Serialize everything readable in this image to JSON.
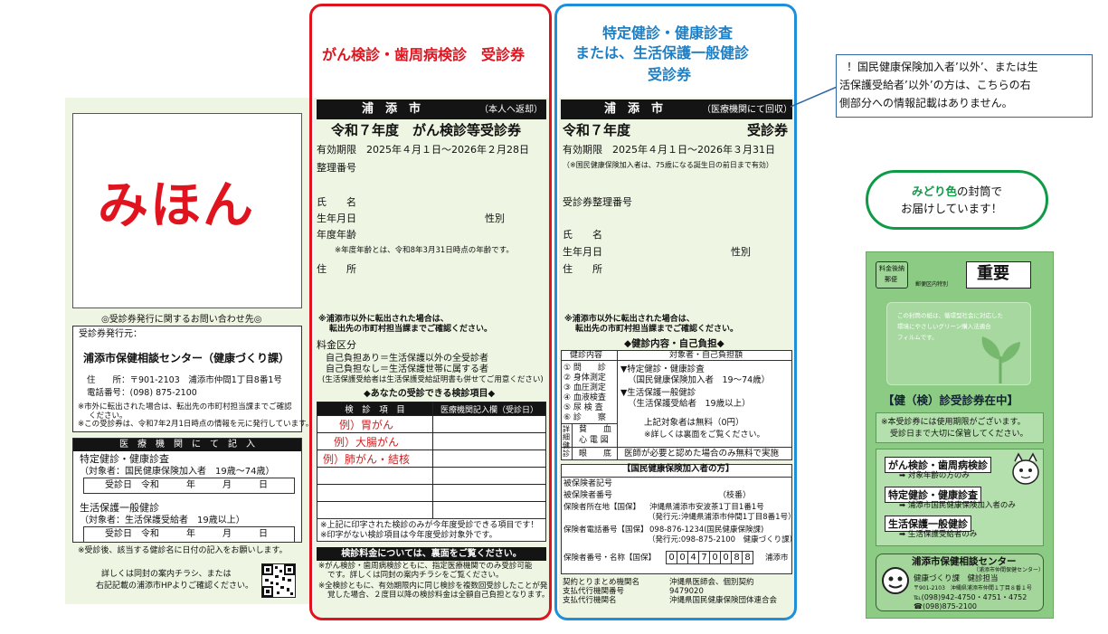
{
  "left": {
    "sample_stamp": "みほん",
    "inquiry_title": "◎受診券発行に関するお問い合わせ先◎",
    "issuer_label": "受診券発行元：",
    "center_name": "浦添市保健相談センター（健康づくり課）",
    "address": "住　　所：〒901-2103　浦添市仲間1丁目8番1号",
    "phone": "電話番号：(098) 875-2100",
    "note1": "※市外に転出された場合は、転出先の市町村担当課までご確認",
    "note1b": "ください。",
    "note2": "※この受診券は、令和7年2月1日時点の情報を元に発行しています。",
    "medical_header": "医　療　機　関　に　て　記　入",
    "tokutei_title": "特定健診・健康診査",
    "tokutei_target": "（対象者：国民健康保険加入者　19歳〜74歳）",
    "date_row": "受診日　令和　　　年　　　月　　　日",
    "seikatsu_title": "生活保護一般健診",
    "seikatsu_target": "（対象者：生活保護受給者　19歳以上）",
    "after_note": "※受診後、該当する健診名に日付の記入をお願いします。",
    "footer1": "詳しくは同封の案内チラシ、または",
    "footer2": "右記記載の浦添市HPよりご確認ください。"
  },
  "middle": {
    "heading": "がん検診・歯周病検診　受診券",
    "city": "浦　添　市",
    "return_tag": "（本人へ返却）",
    "title": "令和７年度　がん検診等受診券",
    "validity": "有効期限　2025年４月１日〜2026年２月28日",
    "ticket_no": "整理番号",
    "name": "氏　　名",
    "dob": "生年月日",
    "sex": "性別",
    "age": "年度年齢",
    "age_note": "※年度年齢とは、令和8年3月31日時点の年齢です。",
    "address": "住　　所",
    "move_note1": "※浦添市以外に転出された場合は、",
    "move_note2": "転出先の市町村担当課までご確認ください。",
    "fee_title": "料金区分",
    "fee1": "自己負担あり＝生活保護以外の全受診者",
    "fee2": "自己負担なし＝生活保護世帯に属する者",
    "fee3": "(生活保護受給者は生活保護受給証明書も併せてご用意ください)",
    "exam_title": "◆あなたの受診できる検診項目◆",
    "col1": "検　診　項　目",
    "col2": "医療機関記入欄（受診日）",
    "items": [
      "例）胃がん",
      "例）大腸がん",
      "例）肺がん・結核"
    ],
    "printed_note1": "※上記に印字された検診のみが今年度受診できる項目です！",
    "printed_note2": "※印字がない検診項目は今年度受診対象外です。",
    "fee_bar": "検診料金については、裏面をご覧ください。",
    "bottom1": "※がん検診・歯周病検診ともに、指定医療機関でのみ受診可能",
    "bottom1b": "です。詳しくは同封の案内チラシをご覧ください。",
    "bottom2": "※全検診ともに、有効期限内に同じ検診を複数回受診したことが発",
    "bottom2b": "覚した場合、２度目以降の検診料金は全額自己負担となります。"
  },
  "right": {
    "heading1": "特定健診・健康診査",
    "heading2": "または、生活保護一般健診",
    "heading3": "受診券",
    "city": "浦　添　市",
    "collect_tag": "（医療機関にて回収）",
    "title_left": "令和７年度",
    "title_right": "受診券",
    "validity": "有効期限　2025年４月１日〜2026年３月31日",
    "validity_note": "（※国民健康保険加入者は、75歳になる誕生日の前日まで有効）",
    "ticket_no": "受診券整理番号",
    "name": "氏　　名",
    "dob": "生年月日",
    "sex": "性別",
    "address": "住　　所",
    "move_note1": "※浦添市以外に転出された場合は、",
    "move_note2": "転出先の市町村担当課までご確認ください。",
    "content_title": "◆健診内容・自己負担◆",
    "col1": "健診内容",
    "col2": "対象者・自己負担額",
    "exam_items": [
      "① 問　　診",
      "② 身体測定",
      "③ 血圧測定",
      "④ 血液検査",
      "⑤ 尿 検 査",
      "⑥ 診　　察"
    ],
    "r_tokutei": "▼特定健診・健康診査",
    "r_tokutei_sub": "（国民健康保険加入者　19〜74歳）",
    "r_seikatsu": "▼生活保護一般健診",
    "r_seikatsu_sub": "（生活保護受給者　19歳以上）",
    "r_free": "上記対象者は無料（0円）",
    "r_back": "※詳しくは裏面をご覧ください。",
    "detail_label": "詳細健診",
    "detail_items": [
      "貧　　血",
      "心 電 図",
      "眼　　底"
    ],
    "doctor_note": "医師が必要と認めた場合のみ無料で実施",
    "insured_header": "【国民健康保険加入者の方】",
    "ins_mark": "被保険者記号",
    "ins_no": "被保険者番号",
    "branch": "（枝番）",
    "ins_addr_label": "保険者所在地【国保】",
    "ins_addr1": "沖縄県浦添市安波茶1丁目1番1号",
    "ins_addr2": "（発行元:沖縄県浦添市仲間1丁目8番1号）",
    "ins_tel_label": "保険者電話番号【国保】",
    "ins_tel1": "098-876-1234(国民健康保険課)",
    "ins_tel2": "（発行元:098-875-2100　健康づくり課）",
    "ins_name_label": "保険者番号・名称【国保】",
    "ins_digits": [
      "0",
      "0",
      "4",
      "7",
      "0",
      "0",
      "8",
      "8"
    ],
    "ins_city": "浦添市",
    "contract_label1": "契約とりまとめ機関名",
    "contract_label2": "支払代行機関番号",
    "contract_label3": "支払代行機関名",
    "contract_val1": "沖縄県医師会、個別契約",
    "contract_val2": "9479020",
    "contract_val3": "沖縄県国民健康保険団体連合会"
  },
  "callout": {
    "line1": "！国民健康保険加入者’以外’、または生",
    "line2": "活保護受給者’以外’の方は、こちらの右",
    "line3": "側部分への情報記載はありません。"
  },
  "green_note": {
    "highlight": "みどり色",
    "line1_rest": "の封筒で",
    "line2": "お届けしています！"
  },
  "envelope": {
    "postage1": "料金後納",
    "postage2": "郵便",
    "postage3": "郵便区内特別",
    "important": "重要",
    "window_text1": "この封筒の紙は、循環型社会に対応した",
    "window_text2": "環境にやさしいグリーン購入法適合",
    "window_text3": "フィルムです。",
    "banner": "【健（検）診受診券在中】",
    "valid_note1": "※本受診券には使用期限がございます。",
    "valid_note2": "受診日まで大切に保管してください。",
    "item1": "がん検診・歯周病検診",
    "item1_sub": "➡ 対象年齢の方のみ",
    "item2": "特定健診・健康診査",
    "item2_sub": "➡ 浦添市国民健康保険加入者のみ",
    "item3": "生活保護一般健診",
    "item3_sub": "➡ 生活保護受給者のみ",
    "center": "浦添市保健相談センター",
    "center_sub": "（浦添市仲間保健センター）",
    "dept": "健康づくり課　健診担当",
    "address": "〒901-2103　沖縄県浦添市仲間１丁目８番１号",
    "fax": "℡(098)942-4750・4751・4752",
    "tel": "☎(098)875-2100"
  },
  "colors": {
    "red_frame": "#e0141e",
    "blue_frame": "#1e8fd8",
    "panel_bg": "#eef5e2",
    "heading_red": "#e0141e",
    "heading_blue": "#1e7fc4",
    "callout_border": "#2f66a8",
    "green_ring": "#0f9a46",
    "envelope_bg": "#8ccb84",
    "item_red": "#d21e1e"
  }
}
